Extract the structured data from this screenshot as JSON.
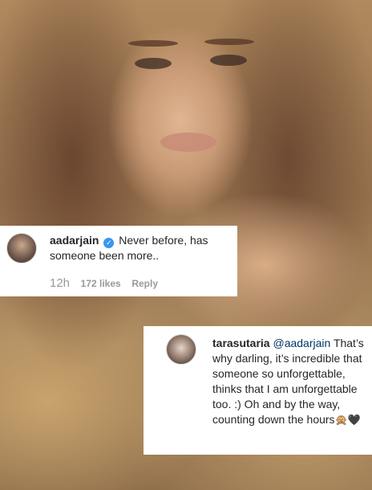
{
  "comment1": {
    "username": "aadarjain",
    "verified": true,
    "text": "Never before, has someone been more..",
    "time": "12h",
    "likes": "172 likes",
    "reply": "Reply"
  },
  "comment2": {
    "username": "tarasutaria",
    "mention": "@aadarjain",
    "text": "That’s why darling, it’s incredible that someone so unforgettable, thinks that I am unforgettable too. :) Oh and by the way, counting down the hours",
    "emoji": "🙊🖤"
  },
  "icons": {
    "verified": "verified-badge-icon"
  },
  "colors": {
    "link": "#003569",
    "verified": "#3897f0",
    "meta": "#999999"
  }
}
